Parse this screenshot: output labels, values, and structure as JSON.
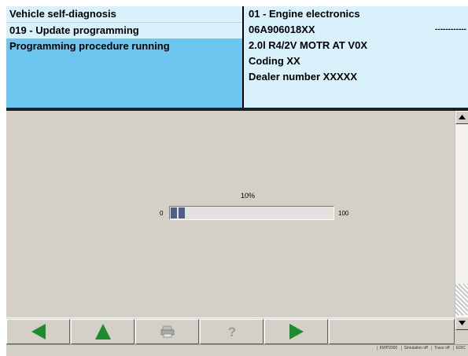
{
  "header": {
    "title": "Vehicle self-diagnosis",
    "function": "019 - Update programming",
    "status": "Programming procedure running"
  },
  "ecu": {
    "name": "01 - Engine electronics",
    "part_number": "06A906018XX",
    "part_suffix": "------------",
    "engine": "2.0l R4/2V  MOTR AT V0X",
    "coding": "Coding  XX",
    "dealer": "Dealer number  XXXXX"
  },
  "progress": {
    "percent_label": "10%",
    "value": 0.1,
    "min_label": "0",
    "max_label": "100"
  },
  "toolbar": {
    "back_icon": "arrow-left-icon",
    "up_icon": "arrow-up-icon",
    "print_icon": "printer-icon",
    "help_icon": "help-icon",
    "next_icon": "arrow-right-icon",
    "accent": "#1e8b2e"
  },
  "statusbar": {
    "version": "KWP2000",
    "simulation": "Simulation off",
    "trace": "Trace off",
    "code": "EDIC"
  },
  "colors": {
    "header_light": "#d9f1fb",
    "header_selected": "#6cc6f0",
    "progress_fill": "#4f5f86"
  }
}
